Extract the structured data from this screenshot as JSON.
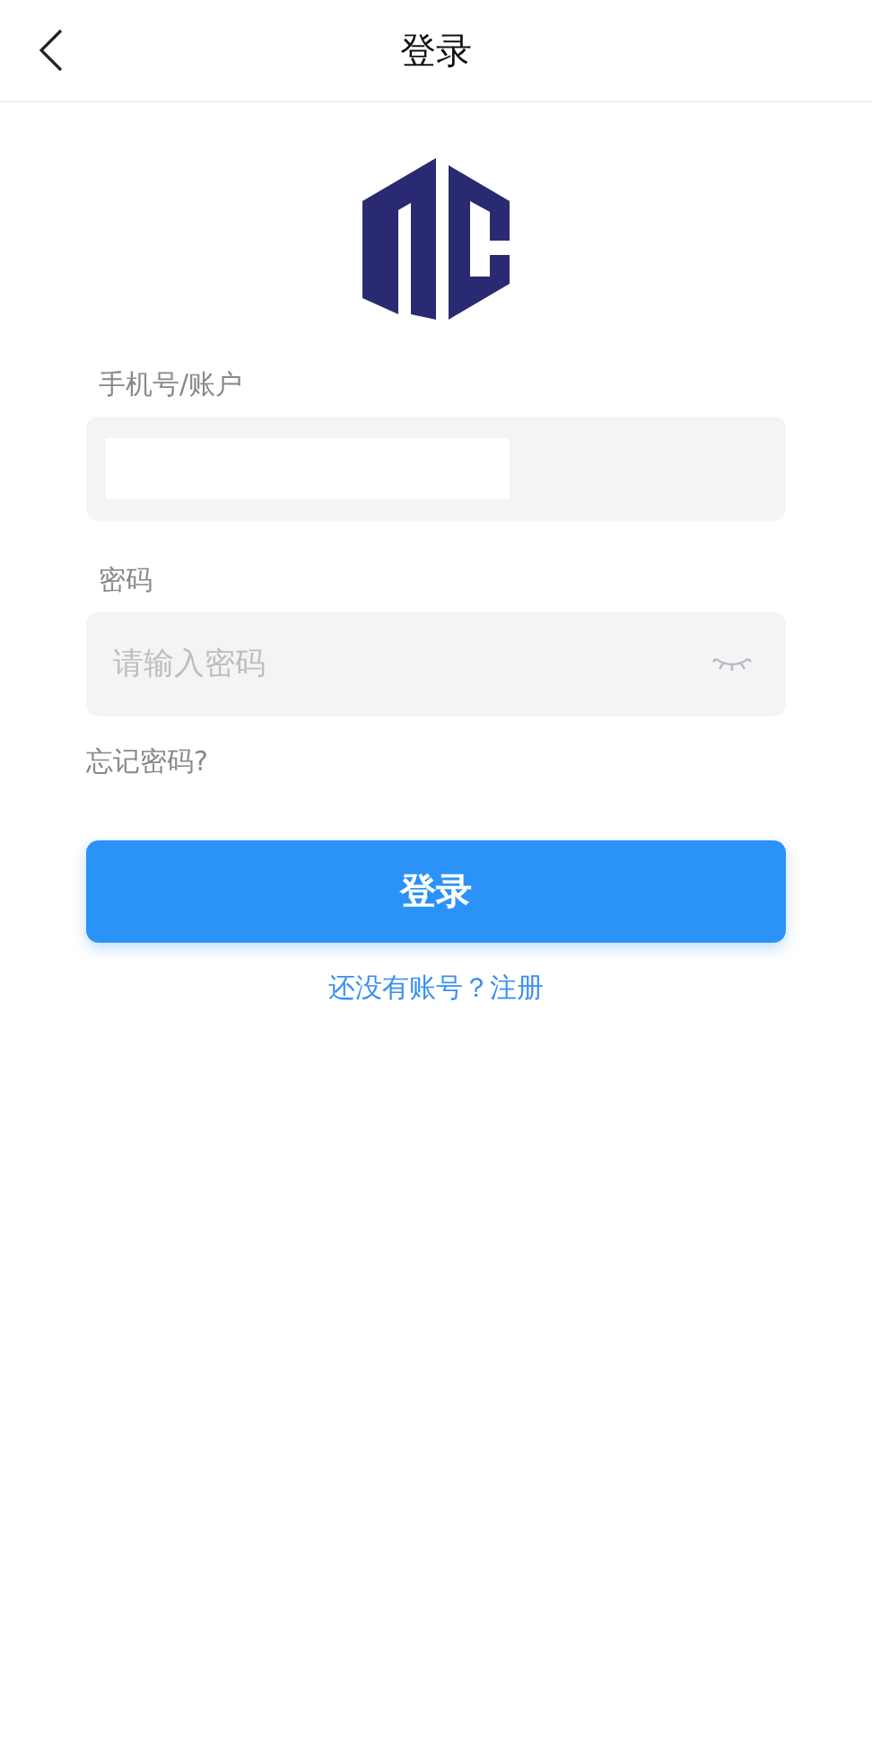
{
  "header": {
    "title": "登录"
  },
  "fields": [
    {
      "kind": "text",
      "label": "手机号/账户"
    },
    {
      "kind": "password",
      "label": "密码",
      "placeholder": "请输入密码"
    }
  ],
  "forgot_link": "忘记密码?",
  "submit_button": "登录",
  "register_link": "还没有账号？注册"
}
